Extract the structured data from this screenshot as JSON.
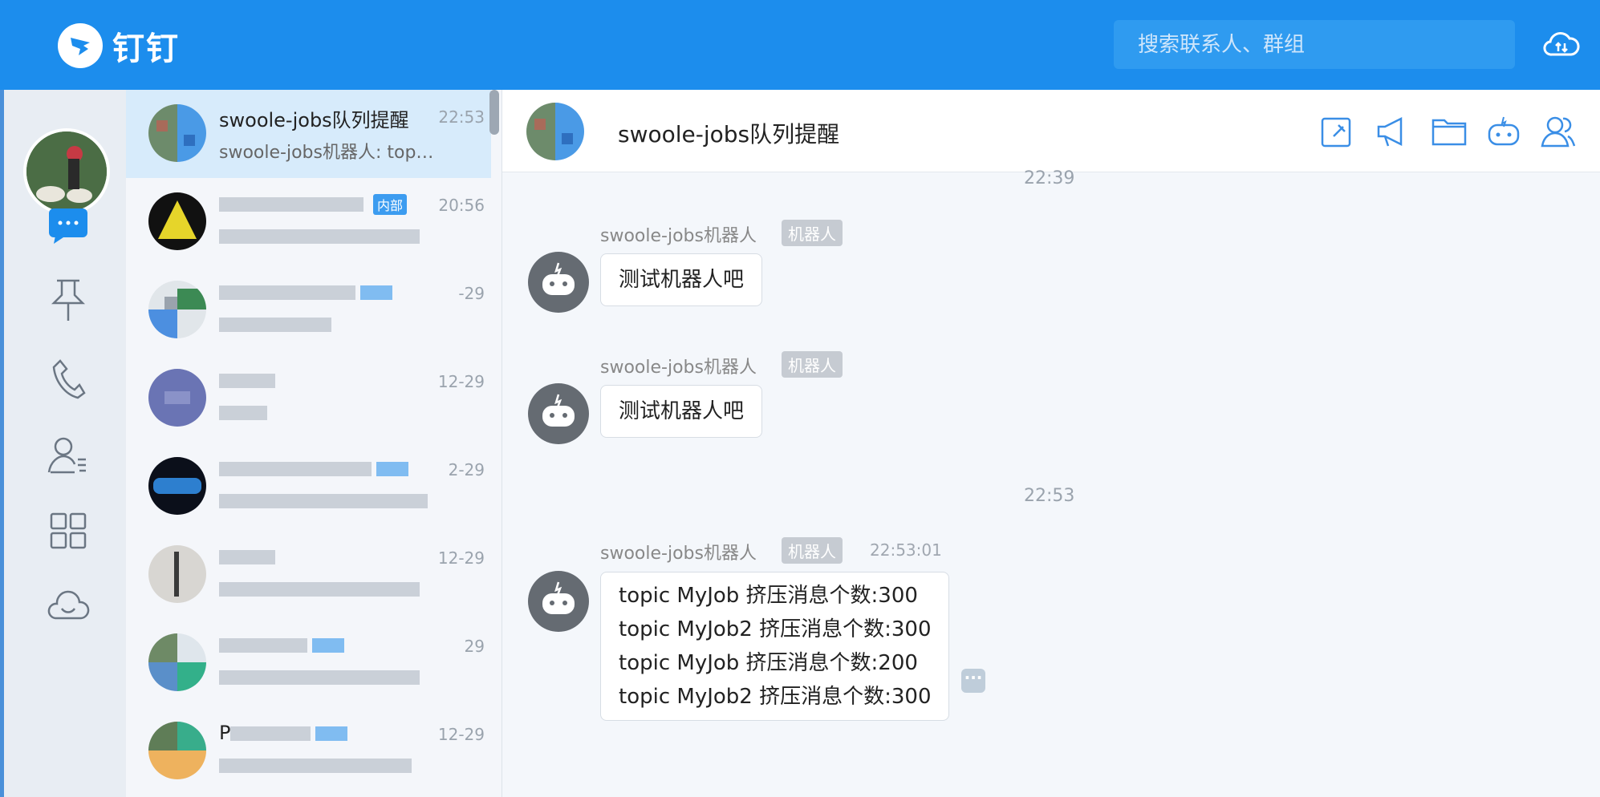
{
  "app": {
    "name": "钉钉"
  },
  "search": {
    "placeholder": "搜索联系人、群组"
  },
  "colors": {
    "brand": "#1c8ded",
    "active_item": "#d7ebfb",
    "badge_blue": "#3c9cf0"
  },
  "nav": {
    "items": [
      {
        "icon": "chat-bubble-icon"
      },
      {
        "icon": "pin-icon"
      },
      {
        "icon": "phone-icon"
      },
      {
        "icon": "contacts-icon"
      },
      {
        "icon": "apps-grid-icon"
      },
      {
        "icon": "cloud-icon"
      }
    ]
  },
  "conversations": [
    {
      "title": "swoole-jobs队列提醒",
      "subtitle": "swoole-jobs机器人: topi...",
      "time": "22:53",
      "active": true
    },
    {
      "title": "",
      "subtitle": "",
      "time": "20:56",
      "badge": "内部"
    },
    {
      "title": "",
      "subtitle": "",
      "time": "-29"
    },
    {
      "title": "",
      "subtitle": "",
      "time": "12-29"
    },
    {
      "title": "",
      "subtitle": "",
      "time": "2-29"
    },
    {
      "title": "",
      "subtitle": "",
      "time": "12-29"
    },
    {
      "title": "",
      "subtitle": "",
      "time": "29"
    },
    {
      "title": "P",
      "subtitle": "",
      "time": "12-29"
    }
  ],
  "chat": {
    "title": "swoole-jobs队列提醒",
    "header_icons": [
      "pin-message-icon",
      "announcement-icon",
      "folder-icon",
      "robot-icon",
      "members-icon"
    ],
    "messages": [
      {
        "time_divider": "22:39"
      },
      {
        "sender": "swoole-jobs机器人",
        "badge": "机器人",
        "lines": [
          "测试机器人吧"
        ]
      },
      {
        "sender": "swoole-jobs机器人",
        "badge": "机器人",
        "lines": [
          "测试机器人吧"
        ]
      },
      {
        "time_divider": "22:53"
      },
      {
        "sender": "swoole-jobs机器人",
        "badge": "机器人",
        "timestamp": "22:53:01",
        "lines": [
          "topic MyJob 挤压消息个数:300",
          "topic MyJob2 挤压消息个数:300",
          "topic MyJob 挤压消息个数:200",
          "topic MyJob2 挤压消息个数:300"
        ]
      }
    ]
  }
}
